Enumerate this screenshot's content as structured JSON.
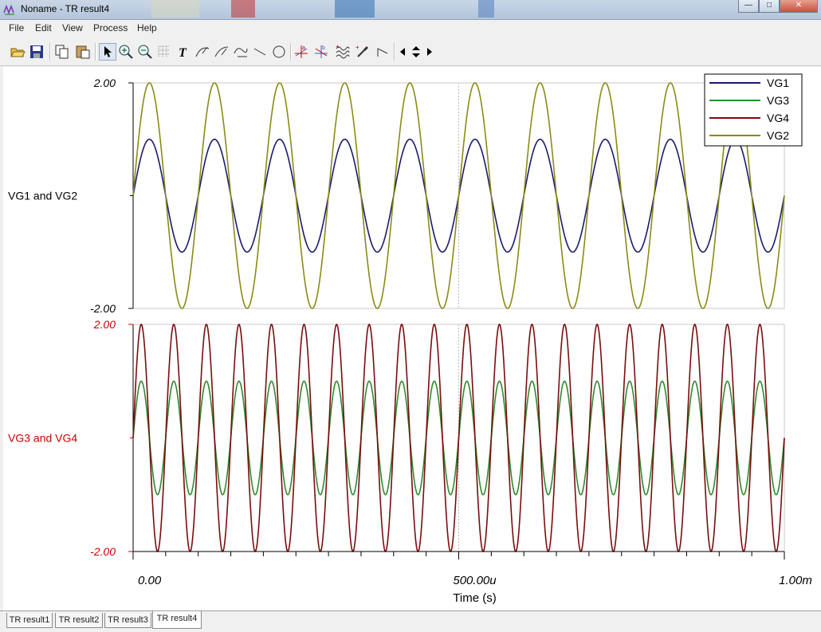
{
  "window": {
    "title": "Noname - TR result4",
    "controls": [
      "—",
      "□",
      "✕"
    ]
  },
  "menu": [
    "File",
    "Edit",
    "View",
    "Process",
    "Help"
  ],
  "toolbar": {
    "icons": [
      "open-icon",
      "save-icon",
      "copy-icon",
      "paste-icon",
      "pointer-icon",
      "zoom-in-icon",
      "zoom-fit-icon",
      "grid-icon",
      "text-icon",
      "curve-label-a-icon",
      "curve-label-b-icon",
      "edit-curve-icon",
      "line-icon",
      "circle-icon",
      "cursor-a-icon",
      "cursor-b-icon",
      "waveform-icon",
      "marker-icon",
      "probe-icon",
      "prev-icon",
      "updown-icon",
      "next-icon"
    ]
  },
  "tabs": [
    "TR result1",
    "TR result2",
    "TR result3",
    "TR result4"
  ],
  "selected_tab": "TR result4",
  "colors": {
    "VG1": "#1a1a6e",
    "VG3": "#2e8b2e",
    "VG4": "#7a0d0d",
    "VG2": "#8b8b14",
    "red_text": "#cc0000"
  },
  "chart_data": [
    {
      "type": "line",
      "ylabel": "VG1 and VG2",
      "ylim": [
        -2.0,
        2.0
      ],
      "y_tick_labels": [
        "2.00",
        "-2.00"
      ],
      "x_tick_labels": [
        "0.00",
        "500.00u",
        "1.00m"
      ],
      "xlim": [
        0,
        0.001
      ],
      "series": [
        {
          "name": "VG1",
          "color": "#1a1a6e",
          "amplitude": 1.0,
          "frequency_hz": 10000,
          "phase": "sin"
        },
        {
          "name": "VG2",
          "color": "#8b8b14",
          "amplitude": 2.0,
          "frequency_hz": 10000,
          "phase": "sin"
        }
      ],
      "legend": {
        "placement": "top-right",
        "entries": [
          "VG1",
          "VG3",
          "VG4",
          "VG2"
        ]
      },
      "grid": false
    },
    {
      "type": "line",
      "ylabel": "VG3 and VG4",
      "ylim": [
        -2.0,
        2.0
      ],
      "y_tick_labels": [
        "2.00",
        "-2.00"
      ],
      "x_tick_labels": [
        "0.00",
        "500.00u",
        "1.00m"
      ],
      "xlim": [
        0,
        0.001
      ],
      "xlabel": "Time (s)",
      "series": [
        {
          "name": "VG3",
          "color": "#2e8b2e",
          "amplitude": 1.0,
          "frequency_hz": 20000,
          "phase": "sin"
        },
        {
          "name": "VG4",
          "color": "#7a0d0d",
          "amplitude": 2.0,
          "frequency_hz": 20000,
          "phase": "sin"
        }
      ],
      "grid": false
    }
  ]
}
